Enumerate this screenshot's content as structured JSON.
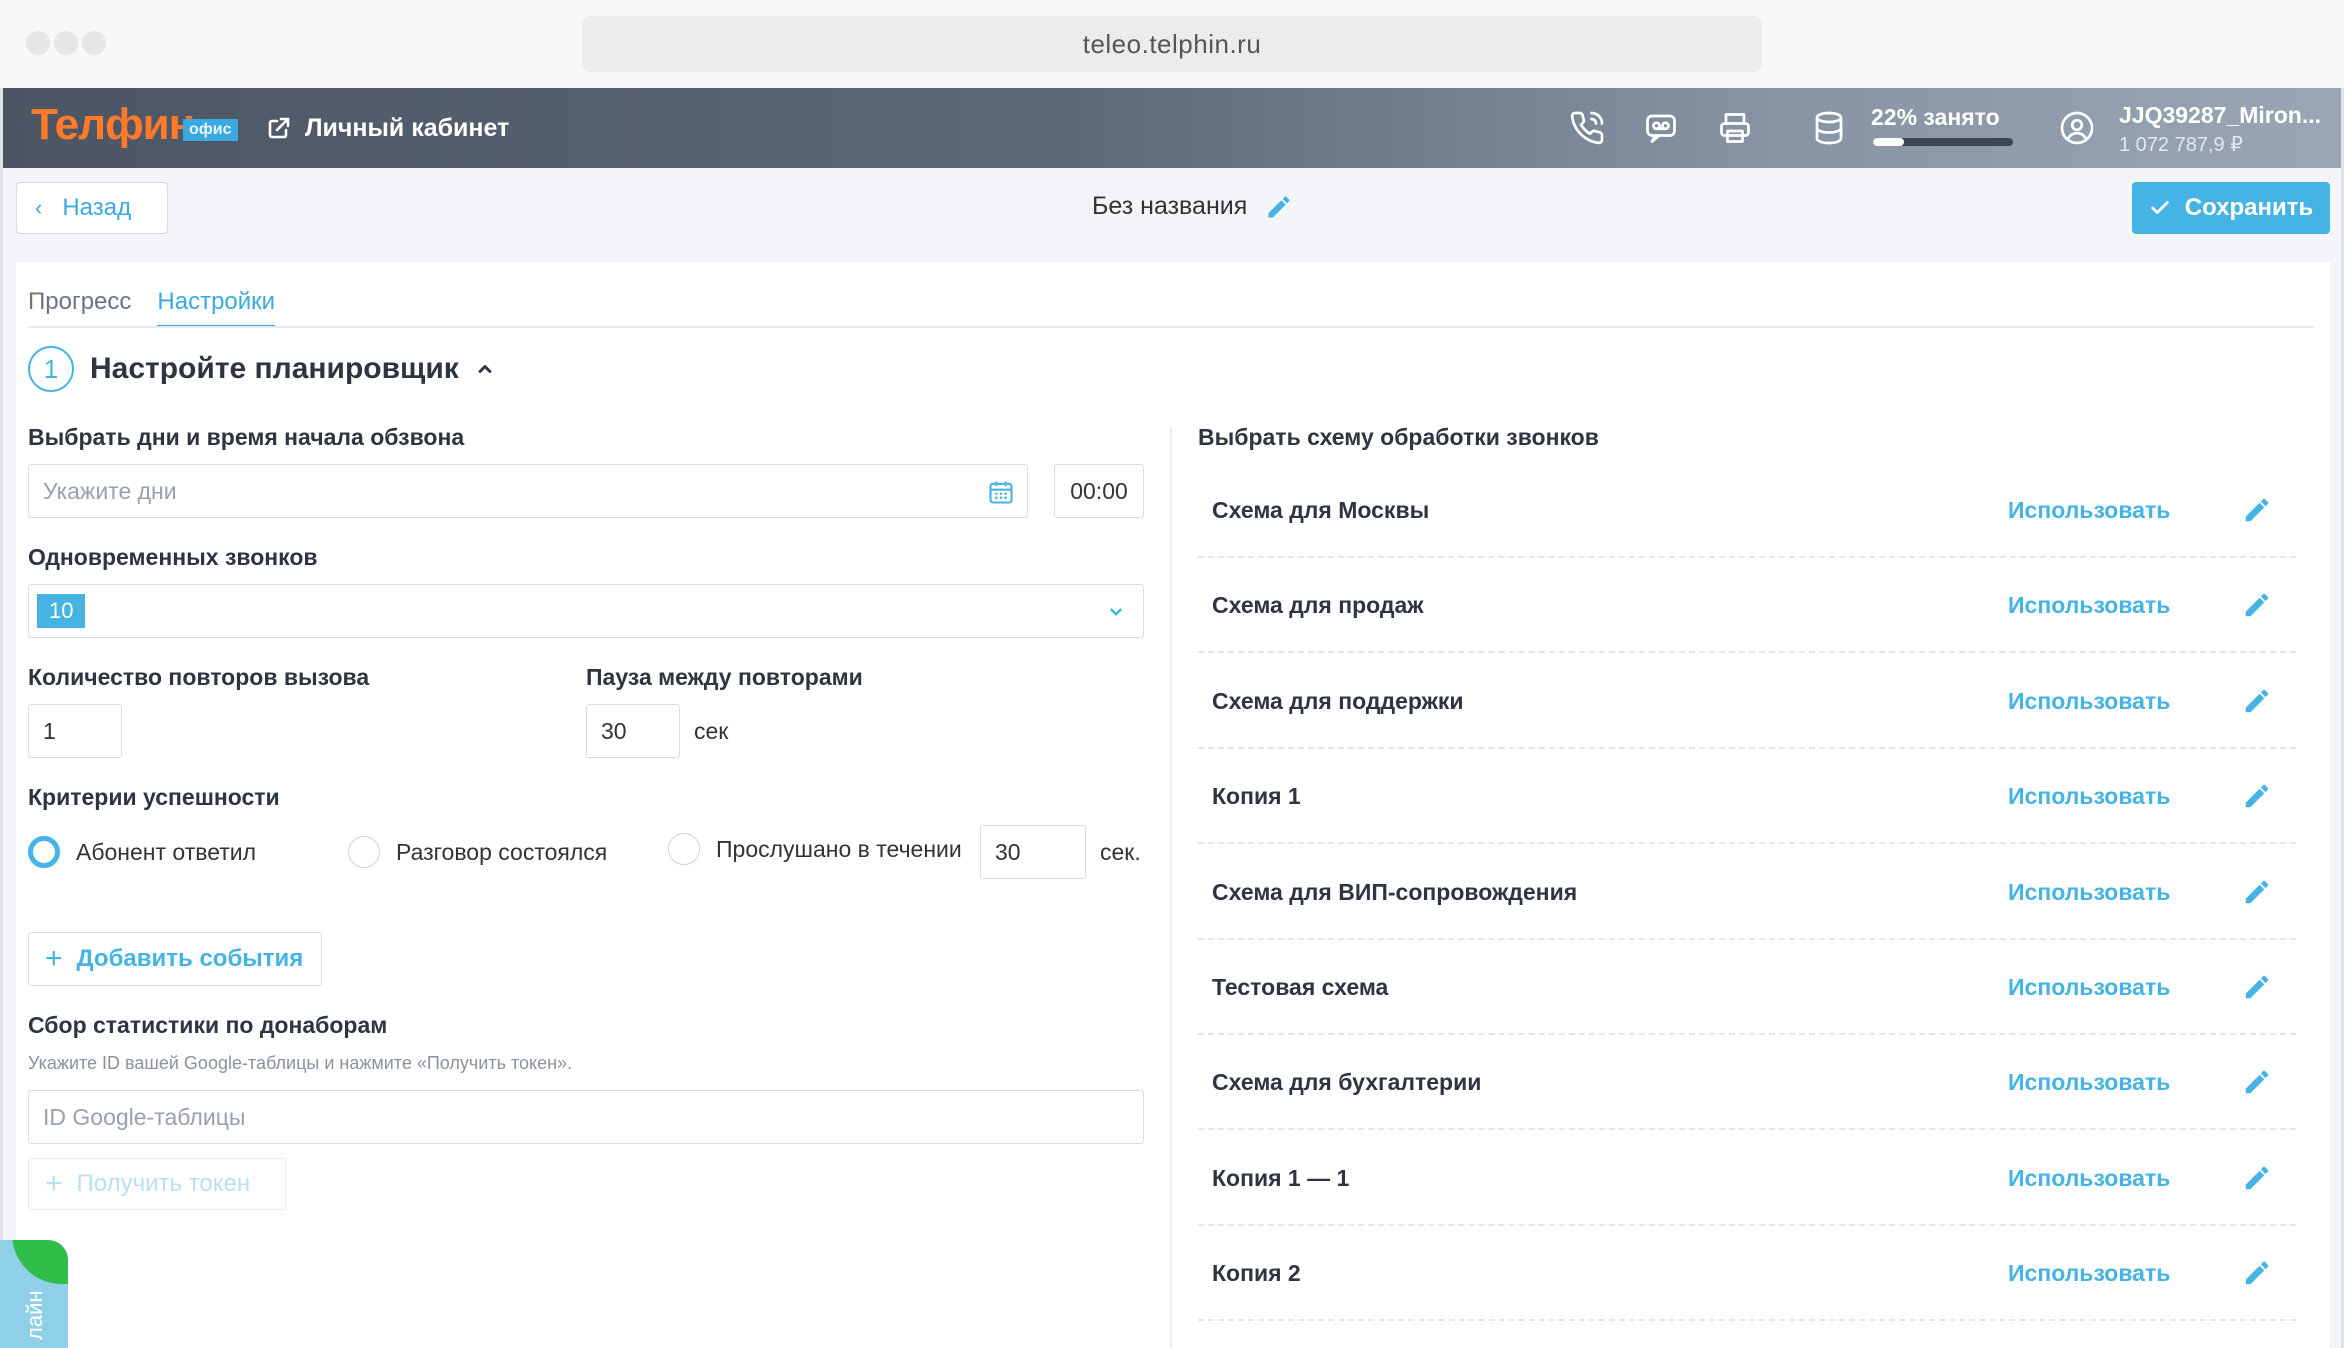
{
  "browser": {
    "url": "teleo.telphin.ru"
  },
  "header": {
    "logo": "Телфин",
    "logo_badge": "офис",
    "personal_cabinet": "Личный кабинет",
    "storage": {
      "text": "22% занято",
      "fraction": 0.22
    },
    "user": {
      "name": "JJQ39287_Miron...",
      "balance": "1 072 787,9 ₽"
    }
  },
  "toolbar": {
    "back_label": "Назад",
    "title": "Без названия",
    "save_label": "Сохранить"
  },
  "tabs": [
    {
      "label": "Прогресс",
      "active": false
    },
    {
      "label": "Настройки",
      "active": true
    }
  ],
  "step": {
    "number": "1",
    "title": "Настройте планировщик"
  },
  "form": {
    "days_label": "Выбрать дни и время начала обзвона",
    "days_placeholder": "Укажите дни",
    "time_value": "00:00",
    "concurrent_label": "Одновременных звонков",
    "concurrent_value": "10",
    "retries_label": "Количество повторов вызова",
    "retries_value": "1",
    "pause_label": "Пауза между повторами",
    "pause_value": "30",
    "pause_unit": "сек",
    "criteria_label": "Критерии успешности",
    "criteria": [
      {
        "label": "Абонент ответил",
        "selected": true
      },
      {
        "label": "Разговор состоялся",
        "selected": false
      },
      {
        "label": "Прослушано в течении",
        "selected": false
      }
    ],
    "listened_value": "30",
    "listened_unit": "сек.",
    "add_events_label": "Добавить события",
    "stats_label": "Сбор статистики по донаборам",
    "stats_hint": "Укажите ID вашей Google-таблицы и нажмите «Получить токен».",
    "stats_placeholder": "ID Google-таблицы",
    "get_token_label": "Получить токен"
  },
  "schemes": {
    "label": "Выбрать схему обработки звонков",
    "use_label": "Использовать",
    "items": [
      {
        "name": "Схема для Москвы"
      },
      {
        "name": "Схема для продаж"
      },
      {
        "name": "Схема для поддержки"
      },
      {
        "name": "Копия 1"
      },
      {
        "name": "Схема для ВИП-сопровождения"
      },
      {
        "name": "Тестовая схема"
      },
      {
        "name": "Схема для бухгалтерии"
      },
      {
        "name": "Копия 1 — 1"
      },
      {
        "name": "Копия 2"
      }
    ]
  },
  "widget": {
    "online_text": "лайн"
  },
  "colors": {
    "accent": "#45b3e4",
    "logo": "#ff7a2a",
    "online_green": "#2ebd49"
  }
}
